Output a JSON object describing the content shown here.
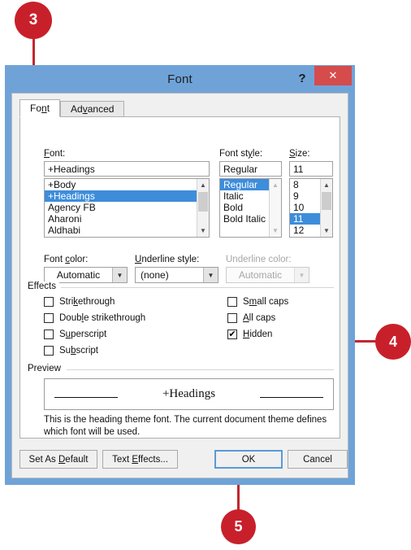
{
  "dialog": {
    "title": "Font",
    "help_label": "?",
    "close_label": "✕",
    "tabs": [
      {
        "label": "Font",
        "active": true
      },
      {
        "label": "Advanced",
        "active": false
      }
    ]
  },
  "font_section": {
    "font_label": "Font:",
    "font_value": "+Headings",
    "font_list": [
      "+Body",
      "+Headings",
      "Agency FB",
      "Aharoni",
      "Aldhabi"
    ],
    "font_selected": "+Headings",
    "style_label": "Font style:",
    "style_value": "Regular",
    "style_list": [
      "Regular",
      "Italic",
      "Bold",
      "Bold Italic"
    ],
    "style_selected": "Regular",
    "size_label": "Size:",
    "size_value": "11",
    "size_list": [
      "8",
      "9",
      "10",
      "11",
      "12"
    ],
    "size_selected": "11"
  },
  "color_row": {
    "font_color_label": "Font color:",
    "font_color_value": "Automatic",
    "underline_style_label": "Underline style:",
    "underline_style_value": "(none)",
    "underline_color_label": "Underline color:",
    "underline_color_value": "Automatic",
    "underline_color_disabled": true
  },
  "effects": {
    "group_label": "Effects",
    "left": [
      {
        "label": "Strikethrough",
        "checked": false
      },
      {
        "label": "Double strikethrough",
        "checked": false
      },
      {
        "label": "Superscript",
        "checked": false
      },
      {
        "label": "Subscript",
        "checked": false
      }
    ],
    "right": [
      {
        "label": "Small caps",
        "checked": false
      },
      {
        "label": "All caps",
        "checked": false
      },
      {
        "label": "Hidden",
        "checked": true
      }
    ],
    "check_glyph": "✔"
  },
  "preview": {
    "group_label": "Preview",
    "sample_text": "+Headings",
    "description": "This is the heading theme font. The current document theme defines which font will be used."
  },
  "buttons": {
    "set_as_default": "Set As Default",
    "text_effects": "Text Effects...",
    "ok": "OK",
    "cancel": "Cancel"
  },
  "callouts": [
    {
      "number": "3"
    },
    {
      "number": "4"
    },
    {
      "number": "5"
    }
  ],
  "colors": {
    "callout_red": "#c8202a",
    "titlebar_blue": "#6fa3d8",
    "selection_blue": "#3d8ddb",
    "close_red": "#d64c4c"
  }
}
